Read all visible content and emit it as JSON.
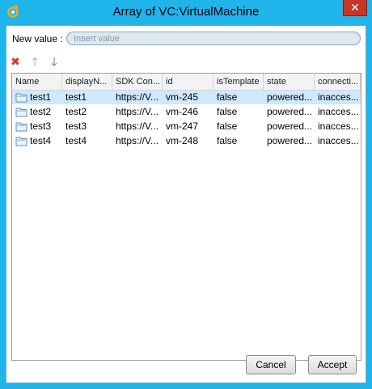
{
  "window": {
    "title": "Array of VC:VirtualMachine",
    "close_glyph": "✕"
  },
  "new_value": {
    "label": "New value :",
    "placeholder": "Insert value",
    "value": ""
  },
  "toolbar": [
    {
      "name": "delete-icon",
      "glyph": "✖",
      "color": "#d9342b"
    },
    {
      "name": "move-up-icon",
      "glyph": "🡑",
      "color": "#9a9a9a"
    },
    {
      "name": "move-down-icon",
      "glyph": "🡓",
      "color": "#1f6fb5"
    }
  ],
  "table": {
    "columns": [
      "Name",
      "displayN...",
      "SDK Con...",
      "id",
      "isTemplate",
      "state",
      "connecti..."
    ],
    "rows": [
      [
        "test1",
        "test1",
        "https://V...",
        "vm-245",
        "false",
        "powered...",
        "inacces..."
      ],
      [
        "test2",
        "test2",
        "https://V...",
        "vm-246",
        "false",
        "powered...",
        "inacces..."
      ],
      [
        "test3",
        "test3",
        "https://V...",
        "vm-247",
        "false",
        "powered...",
        "inacces..."
      ],
      [
        "test4",
        "test4",
        "https://V...",
        "vm-248",
        "false",
        "powered...",
        "inacces..."
      ]
    ],
    "selected_row": 0
  },
  "buttons": {
    "cancel": "Cancel",
    "accept": "Accept"
  },
  "colors": {
    "window_frame": "#1fb4ea",
    "selection": "#cfe8fc",
    "close": "#c9352a"
  }
}
